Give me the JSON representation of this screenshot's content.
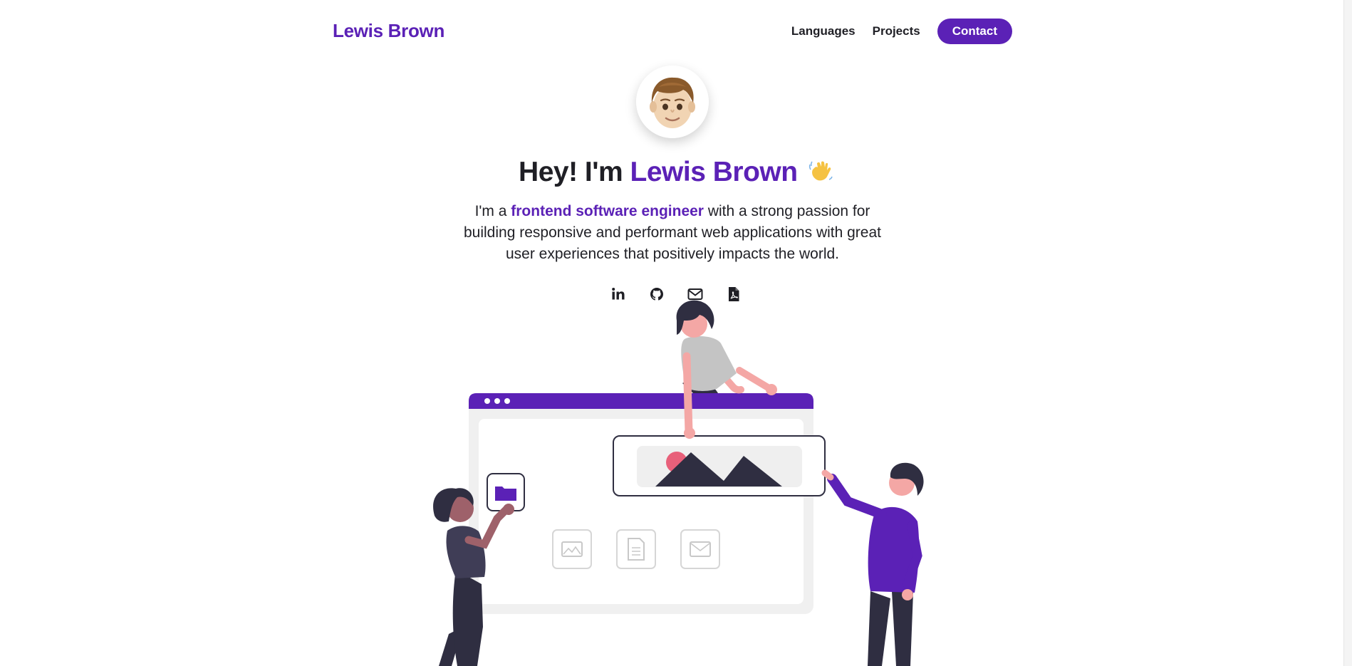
{
  "header": {
    "brand": "Lewis Brown",
    "nav": [
      {
        "label": "Languages"
      },
      {
        "label": "Projects"
      }
    ],
    "contact_label": "Contact"
  },
  "hero": {
    "greeting": "Hey! I'm",
    "name": "Lewis Brown",
    "intro_prefix": "I'm a",
    "intro_highlight": "frontend software engineer",
    "intro_suffix": "with a strong passion for building responsive and performant web applications with great user experiences that positively impacts the world."
  },
  "social": [
    {
      "icon": "linkedin-icon"
    },
    {
      "icon": "github-icon"
    },
    {
      "icon": "envelope-icon"
    },
    {
      "icon": "pdf-file-icon"
    }
  ],
  "colors": {
    "accent": "#5b21b6",
    "text": "#1f1f25",
    "illustration_dark": "#2f2e41",
    "illustration_pink": "#e8607a"
  }
}
